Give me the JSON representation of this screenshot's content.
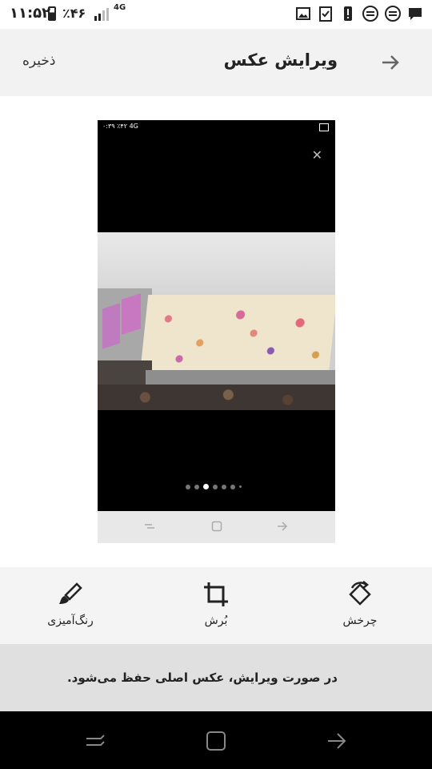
{
  "status_bar": {
    "time": "۱۱:۵۲",
    "battery": "٪۴۶",
    "network": "4G"
  },
  "header": {
    "title": "ویرایش عکس",
    "save_label": "ذخیره"
  },
  "preview": {
    "mini_status": "۰:۳۹ ٪۴۲ 4G",
    "page_dots": 7,
    "active_dot": 3
  },
  "tools": [
    {
      "label": "رنگ‌آمیزی",
      "icon": "brush-icon"
    },
    {
      "label": "بُرش",
      "icon": "crop-icon"
    },
    {
      "label": "چرخش",
      "icon": "rotate-icon"
    }
  ],
  "notice": {
    "text": "در صورت ویرایش، عکس اصلی حفظ می‌شود."
  },
  "colors": {
    "toolbar_bg": "#f2f2f2",
    "notice_bg": "#e0e0e0",
    "nav_bg": "#000000"
  }
}
